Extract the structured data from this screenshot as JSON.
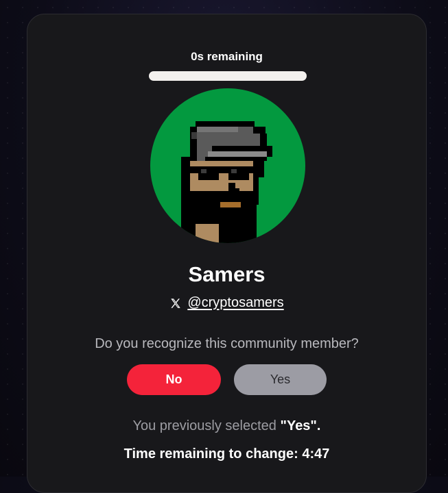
{
  "timer": {
    "label": "0s remaining",
    "progress_fraction": 1.0
  },
  "profile": {
    "display_name": "Samers",
    "handle": "@cryptosamers",
    "platform_icon": "x-logo-icon",
    "avatar_icon": "pixel-punk-avatar",
    "avatar_bg_color": "#03993f"
  },
  "prompt": {
    "question": "Do you recognize this community member?"
  },
  "actions": {
    "no_label": "No",
    "yes_label": "Yes",
    "no_color": "#f4233a",
    "yes_color": "#9c9ca4"
  },
  "status": {
    "previous_prefix": "You previously selected",
    "previous_value": "\"Yes\".",
    "time_change_text": "Time remaining to change: 4:47"
  }
}
